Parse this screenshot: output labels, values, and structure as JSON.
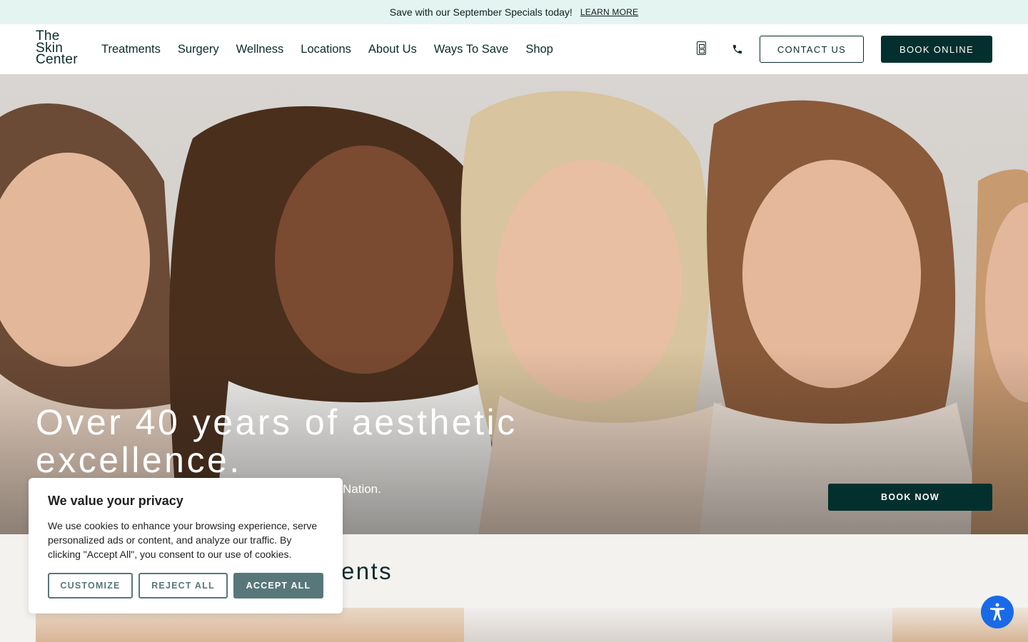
{
  "promo": {
    "text": "Save with our September Specials today!",
    "link": "LEARN MORE"
  },
  "logo": {
    "line1": "The",
    "line2": "Skin",
    "line3": "Center"
  },
  "nav": {
    "items": [
      "Treatments",
      "Surgery",
      "Wellness",
      "Locations",
      "About Us",
      "Ways To Save",
      "Shop"
    ],
    "contact_label": "CONTACT US",
    "book_label": "BOOK ONLINE"
  },
  "hero": {
    "title": "Over 40 years of aesthetic excellence.",
    "subtitle_visible": "Nation.",
    "book_now_label": "BOOK NOW"
  },
  "section": {
    "title_visible": "ents"
  },
  "cookie": {
    "title": "We value your privacy",
    "body": "We use cookies to enhance your browsing experience, serve personalized ads or content, and analyze our traffic. By clicking \"Accept All\", you consent to our use of cookies.",
    "customize": "CUSTOMIZE",
    "reject": "REJECT ALL",
    "accept": "ACCEPT ALL"
  },
  "colors": {
    "brand_dark": "#03302e",
    "promo_bg": "#e4f4f1",
    "cookie_btn": "#58777a",
    "a11y_blue": "#1a6ae8"
  },
  "icons": {
    "qr": "qr-code-icon",
    "phone": "phone-icon",
    "accessibility": "accessibility-icon"
  }
}
